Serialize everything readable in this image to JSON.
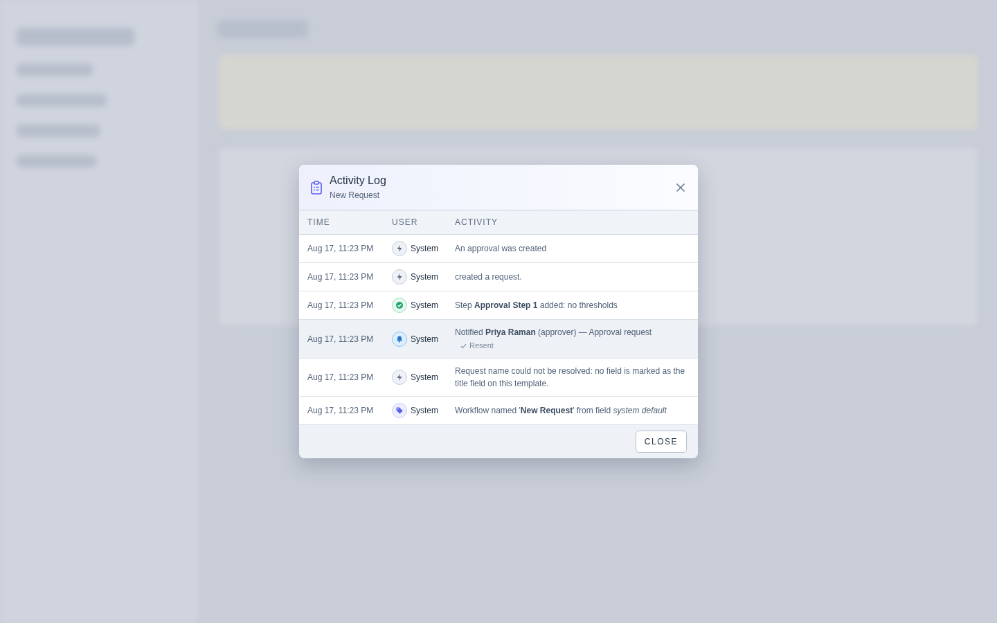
{
  "dialog": {
    "title": "Activity Log",
    "subtitle": "New Request",
    "columns": [
      "TIME",
      "USER",
      "ACTIVITY"
    ],
    "rows": [
      {
        "time": "Aug 17, 11:23 PM",
        "kind": "bolt",
        "user": "System",
        "activity": "An approval was created",
        "selected": false
      },
      {
        "time": "Aug 17, 11:23 PM",
        "kind": "bolt",
        "user": "System",
        "activity": "created a request.",
        "selected": false
      },
      {
        "time": "Aug 17, 11:23 PM",
        "kind": "check",
        "user": "System",
        "activity": "Step **Approval Step 1** added: no thresholds",
        "selected": false
      },
      {
        "time": "Aug 17, 11:23 PM",
        "kind": "bell",
        "user": "System",
        "activity": "Notified **Priya Raman** (approver) — Approval request",
        "note": "Resent",
        "selected": true
      },
      {
        "time": "Aug 17, 11:23 PM",
        "kind": "bolt",
        "user": "System",
        "activity": "Request name could not be resolved: no field is marked as the title field on this template.",
        "selected": false
      },
      {
        "time": "Aug 17, 11:23 PM",
        "kind": "tag",
        "user": "System",
        "activity": "Workflow named '**New Request**' from field *system default*",
        "selected": false
      }
    ],
    "close_button": "CLOSE"
  }
}
